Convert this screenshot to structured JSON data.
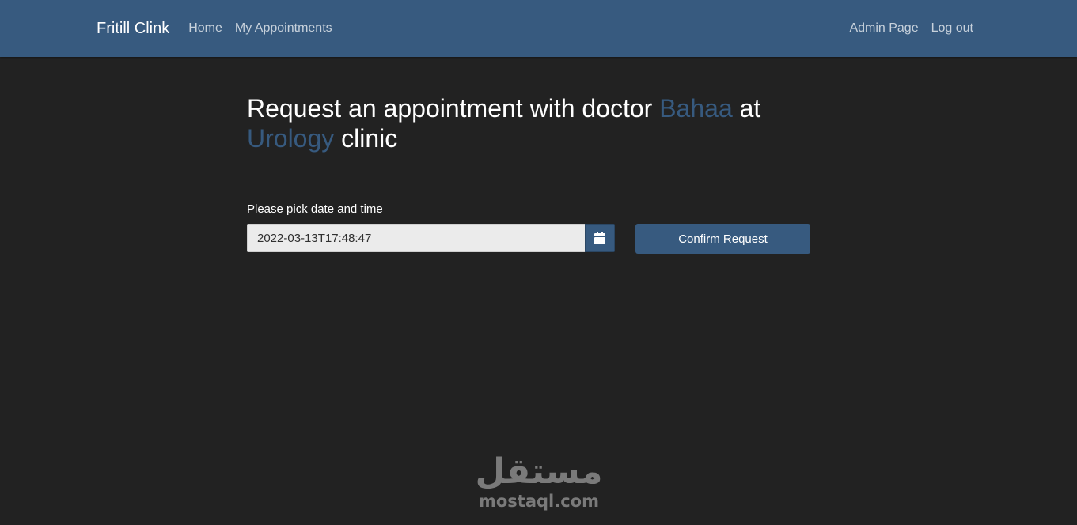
{
  "navbar": {
    "brand": "Fritill Clink",
    "left_links": [
      "Home",
      "My Appointments"
    ],
    "right_links": [
      "Admin Page",
      "Log out"
    ],
    "color": "#375a7f"
  },
  "page": {
    "title_part1": "Request an appointment with doctor ",
    "doctor": "Bahaa",
    "title_part2": " at",
    "clinic": "Urology",
    "title_part3": " clinic",
    "accent_color": "#375a7f"
  },
  "form": {
    "label": "Please pick date and time",
    "datetime_value": "2022-03-13T17:48:47",
    "calendar_icon": "calendar-icon",
    "confirm_label": "Confirm Request"
  },
  "watermark": {
    "arabic": "مستقل",
    "latin": "mostaql.com"
  }
}
